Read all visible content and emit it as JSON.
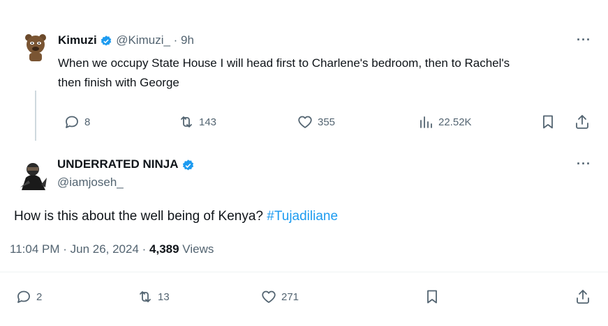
{
  "quoted_tweet": {
    "display_name": "Kimuzi",
    "handle": "@Kimuzi_",
    "time_sep": " · ",
    "time": "9h",
    "text_line1": "When we occupy State House I will head first to Charlene's bedroom, then to Rachel's",
    "text_line2": "then finish with George",
    "replies": "8",
    "retweets": "143",
    "likes": "355",
    "views": "22.52K",
    "more": "···"
  },
  "reply_tweet": {
    "display_name": "UNDERRATED NINJA",
    "handle": "@iamjoseh_",
    "text": "How is this about the well being of Kenya? ",
    "hashtag": "#Tujadiliane",
    "timestamp": "11:04 PM · Jun 26, 2024 · ",
    "views_count": "4,389",
    "views_label": " Views",
    "replies": "2",
    "retweets": "13",
    "likes": "271",
    "more": "···"
  },
  "icons": {
    "verified": "verified-badge-icon",
    "reply": "reply-icon",
    "retweet": "retweet-icon",
    "like": "heart-icon",
    "views": "analytics-icon",
    "bookmark": "bookmark-icon",
    "share": "share-icon",
    "more": "more-icon"
  },
  "colors": {
    "accent": "#1d9bf0",
    "muted": "#536471",
    "text": "#0f1419"
  }
}
